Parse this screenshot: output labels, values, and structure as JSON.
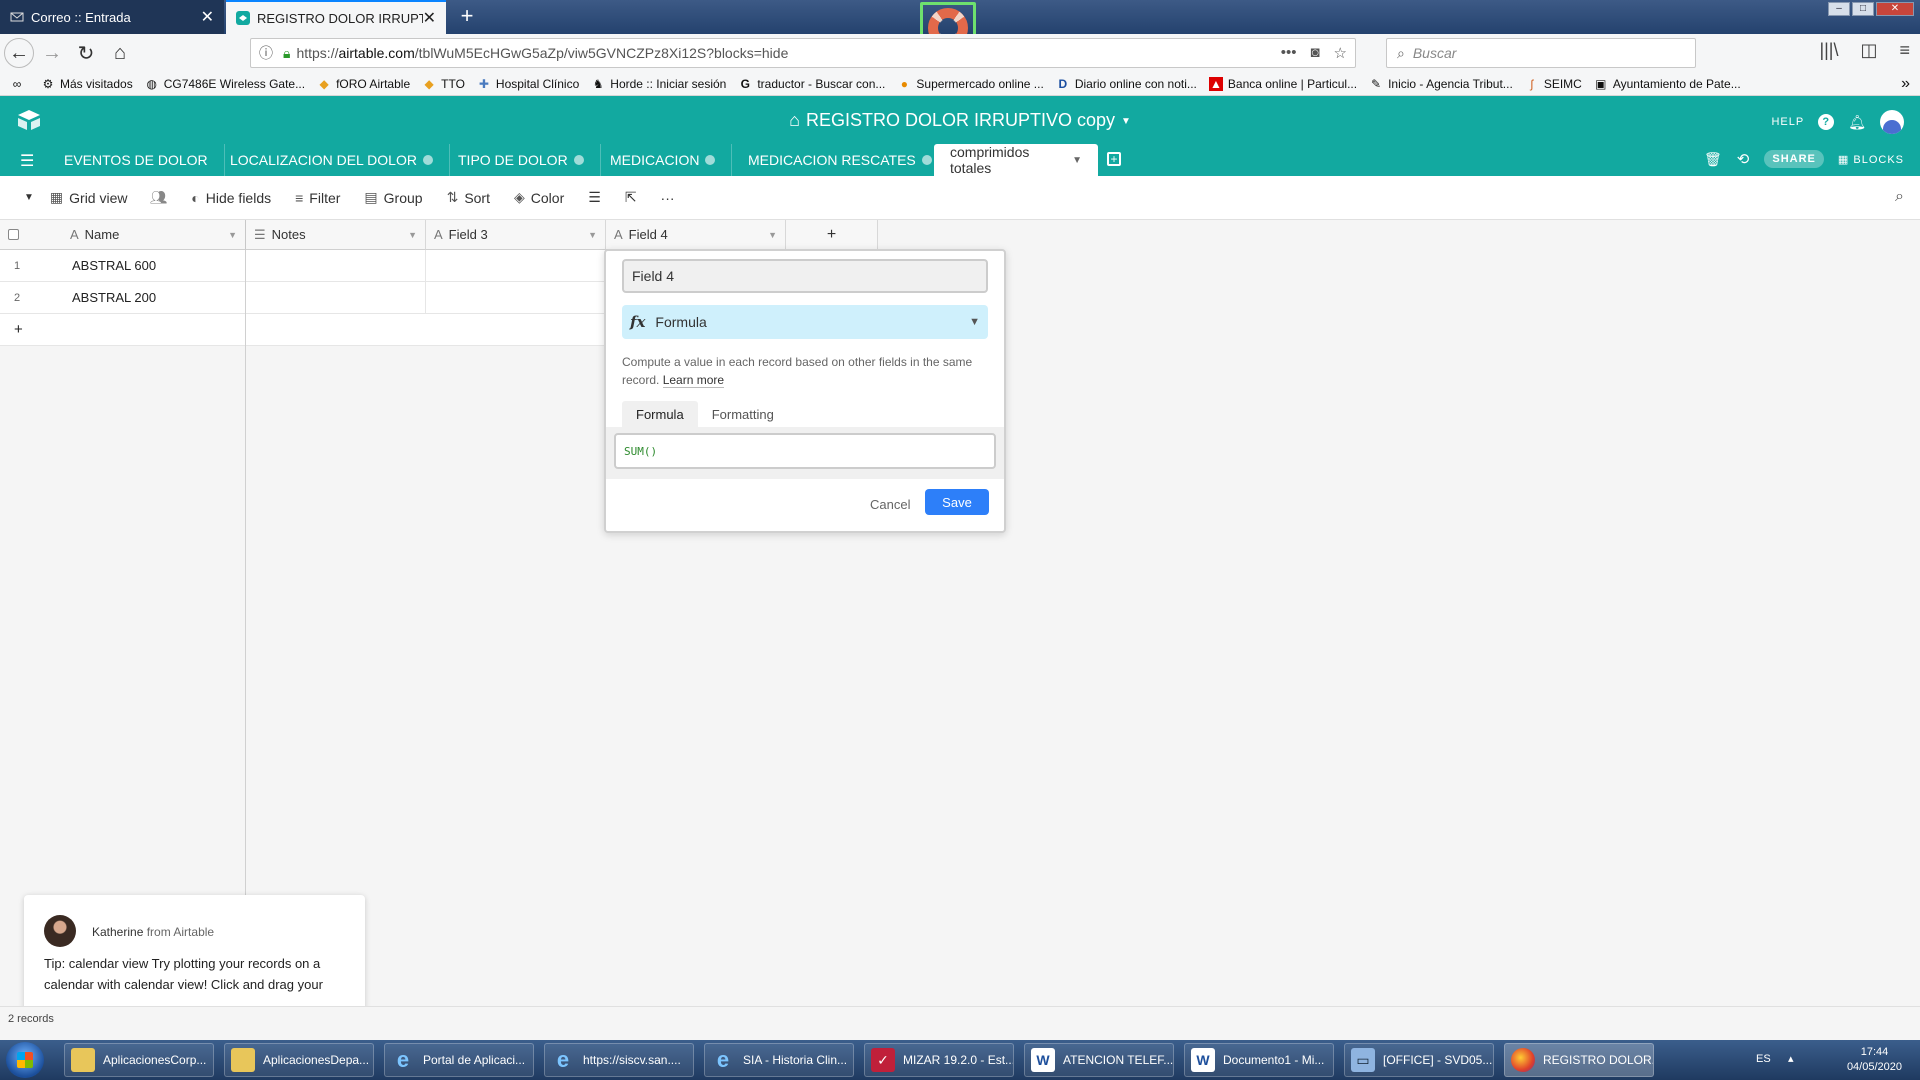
{
  "browser": {
    "tabs": [
      {
        "label": "Correo :: Entrada",
        "active": false
      },
      {
        "label": "REGISTRO DOLOR IRRUPTIVO c",
        "active": true
      }
    ],
    "url_prefix": "https://",
    "url_host": "airtable.com",
    "url_path": "/tblWuM5EcHGwG5aZp/viw5GVNCZPz8Xi12S?blocks=hide",
    "search_placeholder": "Buscar",
    "bookmarks": [
      "Más visitados",
      "CG7486E Wireless Gate...",
      "fORO Airtable",
      "TTO",
      "Hospital Clínico",
      "Horde :: Iniciar sesión",
      "traductor - Buscar con...",
      "Supermercado online ...",
      "Diario online con noti...",
      "Banca online | Particul...",
      "Inicio - Agencia Tribut...",
      "SEIMC",
      "Ayuntamiento de Pate..."
    ]
  },
  "airtable": {
    "base_title": "REGISTRO DOLOR IRRUPTIVO copy",
    "help_label": "HELP",
    "tables": [
      {
        "label": "EVENTOS DE DOLOR",
        "info": false
      },
      {
        "label": "LOCALIZACION DEL DOLOR",
        "info": true
      },
      {
        "label": "TIPO DE DOLOR",
        "info": true
      },
      {
        "label": "MEDICACION",
        "info": true
      },
      {
        "label": "MEDICACION RESCATES",
        "info": true
      },
      {
        "label": "comprimidos totales",
        "active": true
      }
    ],
    "share_label": "SHARE",
    "blocks_label": "BLOCKS",
    "toolbar": {
      "view_name": "Grid view",
      "hide_fields": "Hide fields",
      "filter": "Filter",
      "group": "Group",
      "sort": "Sort",
      "color": "Color",
      "more": "···"
    },
    "grid": {
      "columns": [
        "Name",
        "Notes",
        "Field 3",
        "Field 4"
      ],
      "add_column": "+",
      "rows": [
        {
          "num": "1",
          "name": "ABSTRAL 600"
        },
        {
          "num": "2",
          "name": "ABSTRAL 200"
        }
      ],
      "add_row": "+"
    },
    "field_editor": {
      "field_name": "Field 4",
      "field_type": "Formula",
      "description": "Compute a value in each record based on other fields in the same record.",
      "learn_more": "Learn more",
      "tab_formula": "Formula",
      "tab_formatting": "Formatting",
      "formula_value": "SUM()",
      "cancel": "Cancel",
      "save": "Save"
    },
    "tip": {
      "author": "Katherine",
      "from": "from Airtable",
      "text": "Tip: calendar view Try plotting your records on a calendar with calendar view! Click and drag your"
    },
    "record_count": "2 records"
  },
  "taskbar": {
    "items": [
      "AplicacionesCorp...",
      "AplicacionesDepa...",
      "Portal de Aplicaci...",
      "https://siscv.san....",
      "SIA - Historia Clin...",
      "MIZAR 19.2.0 - Est...",
      "ATENCION TELEF...",
      "Documento1 - Mi...",
      "[OFFICE] - SVD05...",
      "REGISTRO DOLOR..."
    ],
    "lang": "ES",
    "time": "17:44",
    "date": "04/05/2020"
  },
  "colors": {
    "brand": "#12a9a0",
    "save_button": "#2d7ff9",
    "formula_type_bg": "#cff0fc"
  }
}
